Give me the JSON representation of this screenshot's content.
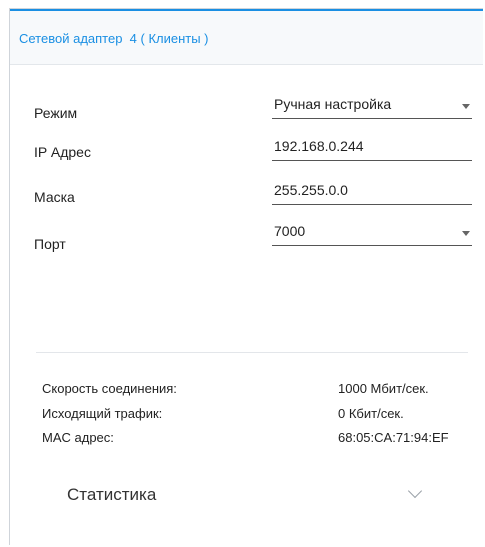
{
  "card": {
    "title": "Сетевой адаптер  4 ( Клиенты )"
  },
  "form": {
    "mode": {
      "label": "Режим",
      "value": "Ручная настройка"
    },
    "ip": {
      "label": "IP Адрес",
      "value": "192.168.0.244"
    },
    "mask": {
      "label": "Маска",
      "value": "255.255.0.0"
    },
    "port": {
      "label": "Порт",
      "value": "7000"
    }
  },
  "info": {
    "speed": {
      "label": "Скорость соединения:",
      "value": "1000 Мбит/сек."
    },
    "traffic": {
      "label": "Исходящий трафик:",
      "value": "0 Кбит/сек."
    },
    "mac": {
      "label": "MAC адрес:",
      "value": "68:05:CA:71:94:EF"
    }
  },
  "stats": {
    "label": "Статистика",
    "icon": "chevron-down-icon"
  },
  "colors": {
    "accent": "#1a8fe3",
    "text": "#222222",
    "underline": "#555555"
  }
}
